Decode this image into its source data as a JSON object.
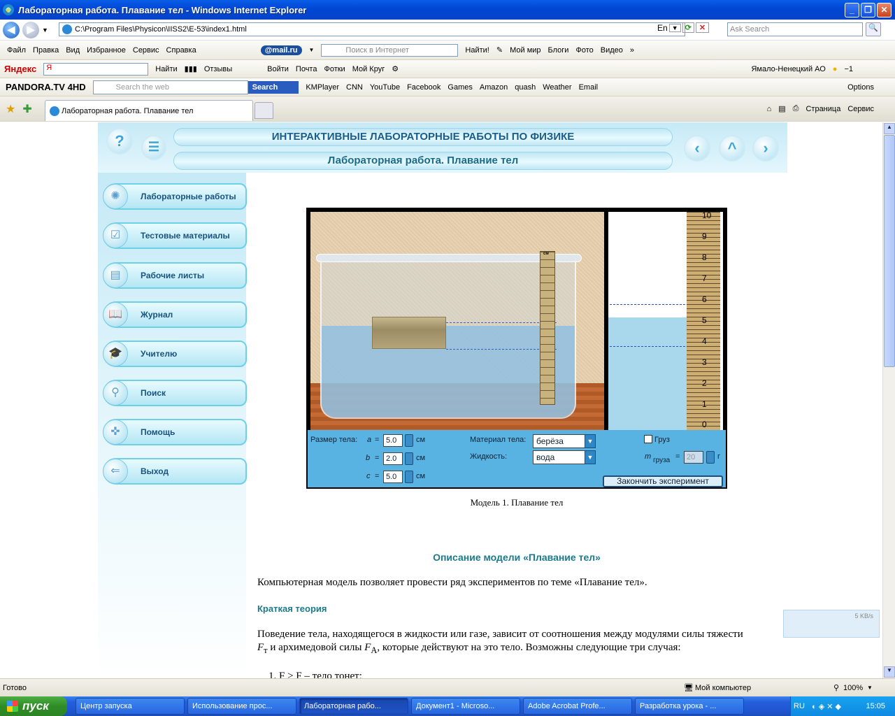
{
  "window": {
    "title": "Лабораторная работа. Плавание тел - Windows Internet Explorer"
  },
  "address": {
    "url": "C:\\Program Files\\Physicon\\IISS2\\E-53\\index1.html",
    "lang": "En",
    "search_placeholder": "Ask Search"
  },
  "menubar": {
    "items": [
      "Файл",
      "Правка",
      "Вид",
      "Избранное",
      "Сервис",
      "Справка"
    ],
    "mailru": "@mail.ru",
    "search_placeholder": "Поиск в Интернет",
    "find": "Найти!",
    "links": [
      "Мой мир",
      "Блоги",
      "Фото",
      "Видео"
    ]
  },
  "yandex": {
    "logo": "Яндекс",
    "find": "Найти",
    "items": [
      "Отзывы",
      "Войти",
      "Почта",
      "Фотки",
      "Мой Круг"
    ],
    "region": "Ямало-Ненецкий АО",
    "temp": "−1"
  },
  "pandora": {
    "logo": "PANDORA.TV 4HD",
    "search_placeholder": "Search the web",
    "search_btn": "Search",
    "links": [
      "KMPlayer",
      "CNN",
      "YouTube",
      "Facebook",
      "Games",
      "Amazon",
      "quash",
      "Weather",
      "Email"
    ],
    "options": "Options"
  },
  "tabs": {
    "active": "Лабораторная работа. Плавание тел",
    "page": "Страница",
    "tools": "Сервис"
  },
  "header": {
    "title": "ИНТЕРАКТИВНЫЕ ЛАБОРАТОРНЫЕ РАБОТЫ ПО ФИЗИКЕ",
    "subtitle": "Лабораторная работа. Плавание тел"
  },
  "sidebar": {
    "items": [
      {
        "label": "Лабораторные работы",
        "icon": "bulb-icon"
      },
      {
        "label": "Тестовые материалы",
        "icon": "check-icon"
      },
      {
        "label": "Рабочие листы",
        "icon": "sheets-icon"
      },
      {
        "label": "Журнал",
        "icon": "book-icon"
      },
      {
        "label": "Учителю",
        "icon": "graduation-cap-icon"
      },
      {
        "label": "Поиск",
        "icon": "binoculars-icon"
      },
      {
        "label": "Помощь",
        "icon": "lifebuoy-icon"
      },
      {
        "label": "Выход",
        "icon": "exit-icon"
      }
    ]
  },
  "sim": {
    "ruler_unit": "см",
    "gauge_labels": [
      "10",
      "9",
      "8",
      "7",
      "6",
      "5",
      "4",
      "3",
      "2",
      "1",
      "0"
    ],
    "size_label": "Размер тела:",
    "a_label": "a",
    "b_label": "b",
    "c_label": "c",
    "eq": "=",
    "a": "5.0",
    "b": "2.0",
    "c": "5.0",
    "unit": "см",
    "material_label": "Материал тела:",
    "material": "берёза",
    "liquid_label": "Жидкость:",
    "liquid": "вода",
    "load_label": "Груз",
    "load_checked": false,
    "mass_label": "m",
    "mass_sub": "груза",
    "mass": "20",
    "mass_unit": "г",
    "finish": "Закончить эксперимент"
  },
  "caption": "Модель 1. Плавание тел",
  "article": {
    "heading": "Описание модели «Плавание тел»",
    "intro": "Компьютерная модель позволяет провести ряд экспериментов по теме «Плавание тел».",
    "subheading": "Краткая теория",
    "theory_1": "Поведение тела, находящегося в жидкости или газе, зависит от соотношения между модулями силы тяжести",
    "theory_2a": "F",
    "theory_2b": "т",
    "theory_2c": " и архимедовой силы ",
    "theory_2d": "F",
    "theory_2e": "A",
    "theory_2f": ", которые действуют на это тело. Возможны следующие три случая:",
    "list_1": "1.   F  > F  – тело тонет;"
  },
  "floatbox": {
    "speed": "5 KB/s"
  },
  "status": {
    "left": "Готово",
    "zone": "Мой компьютер",
    "zoom": "100%"
  },
  "taskbar": {
    "start": "пуск",
    "tasks": [
      "Центр запуска",
      "Использование прос...",
      "Лабораторная рабо...",
      "Документ1 - Microso...",
      "Adobe Acrobat Profe...",
      "Разработка урока - ..."
    ],
    "lang": "RU",
    "time": "15:05"
  }
}
